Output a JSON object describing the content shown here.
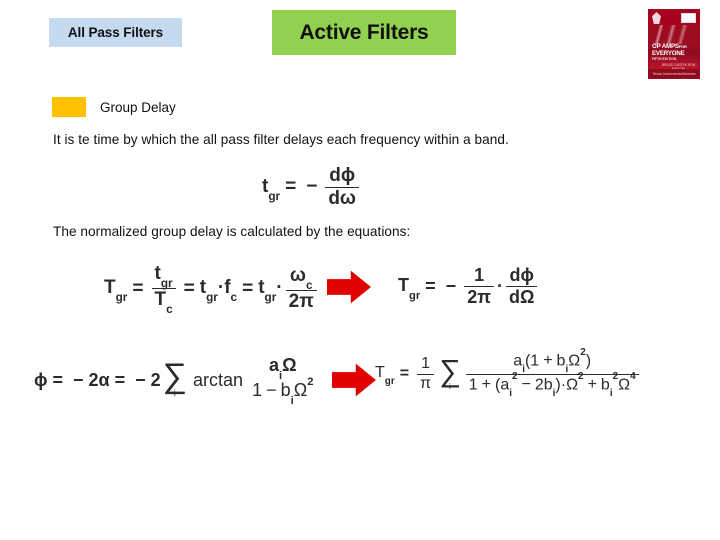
{
  "slide": {
    "background_color": "#ffffff",
    "tabs": {
      "all_pass": {
        "label": "All Pass Filters",
        "bg_color": "#c5d9ef"
      },
      "active": {
        "label": "Active Filters",
        "bg_color": "#92d050"
      }
    },
    "book_cover": {
      "title_line1": "OP AMPS",
      "title_for": "FOR",
      "title_line2": "EVERYONE",
      "edition": "FIFTH EDITION",
      "authors": "BRUCE CARTER  RON MANCINI",
      "publisher": "Texas Instruments/Newnes"
    },
    "bullet": {
      "label": "Group Delay",
      "marker_color": "#ffc000"
    },
    "paragraphs": {
      "p1": "It is te time by which the all pass filter delays each frequency within a band.",
      "p2": "The normalized group delay is calculated by the equations:"
    },
    "arrows": {
      "color": "#e00000",
      "count": 2
    },
    "equations": {
      "eq1": {
        "lhs_base": "t",
        "lhs_sub": "gr",
        "equals": "=",
        "minus": "−",
        "frac_num": "dϕ",
        "frac_den": "dω"
      },
      "eq2_left": {
        "lhs_base": "T",
        "lhs_sub": "gr",
        "equals": "=",
        "f1_num_base": "t",
        "f1_num_sub": "gr",
        "f1_den_base": "T",
        "f1_den_sub": "c",
        "term2_base": "t",
        "term2_sub": "gr",
        "term2_dot": "·",
        "term2_b_base": "f",
        "term2_b_sub": "c",
        "term3_base": "t",
        "term3_sub": "gr",
        "term3_dot": "·",
        "term3_num_base": "ω",
        "term3_num_sub": "c",
        "term3_den": "2π"
      },
      "eq2_right": {
        "lhs_base": "T",
        "lhs_sub": "gr",
        "equals": "=",
        "minus": "−",
        "f1_num": "1",
        "f1_den": "2π",
        "dot": "·",
        "f2_num": "dϕ",
        "f2_den": "dΩ"
      },
      "eq3_left": {
        "phi": "ϕ",
        "equals1": "=",
        "minus1": "−",
        "two_alpha": "2α",
        "equals2": "=",
        "minus2": "−",
        "two": "2",
        "sigma": "∑",
        "sigma_index": "i",
        "arctan": "arctan",
        "num_a": "a",
        "num_sub": "i",
        "num_omega": "Ω",
        "den_one": "1",
        "den_minus": "−",
        "den_b": "b",
        "den_sub": "i",
        "den_omega": "Ω",
        "den_sup": "2"
      },
      "eq3_right": {
        "lhs_base": "T",
        "lhs_sub": "gr",
        "equals": "=",
        "pref_num": "1",
        "pref_den": "π",
        "sigma": "∑",
        "sigma_index": "i",
        "num_a": "a",
        "num_a_sub": "i",
        "num_open": "(",
        "num_one": "1",
        "num_plus": "+",
        "num_b": "b",
        "num_b_sub": "i",
        "num_omega": "Ω",
        "num_sup": "2",
        "num_close": ")",
        "den_one": "1",
        "den_plus1": "+",
        "den_open": "(",
        "den_a": "a",
        "den_a_sub": "i",
        "den_a_sup": "2",
        "den_minus": "−",
        "den_2b": "2b",
        "den_b_sub": "i",
        "den_close": ")",
        "den_dot": "·",
        "den_omega1": "Ω",
        "den_omega1_sup": "2",
        "den_plus2": "+",
        "den_b2": "b",
        "den_b2_sub": "i",
        "den_b2_sup": "2",
        "den_omega2": "Ω",
        "den_omega2_sup": "4"
      }
    }
  }
}
